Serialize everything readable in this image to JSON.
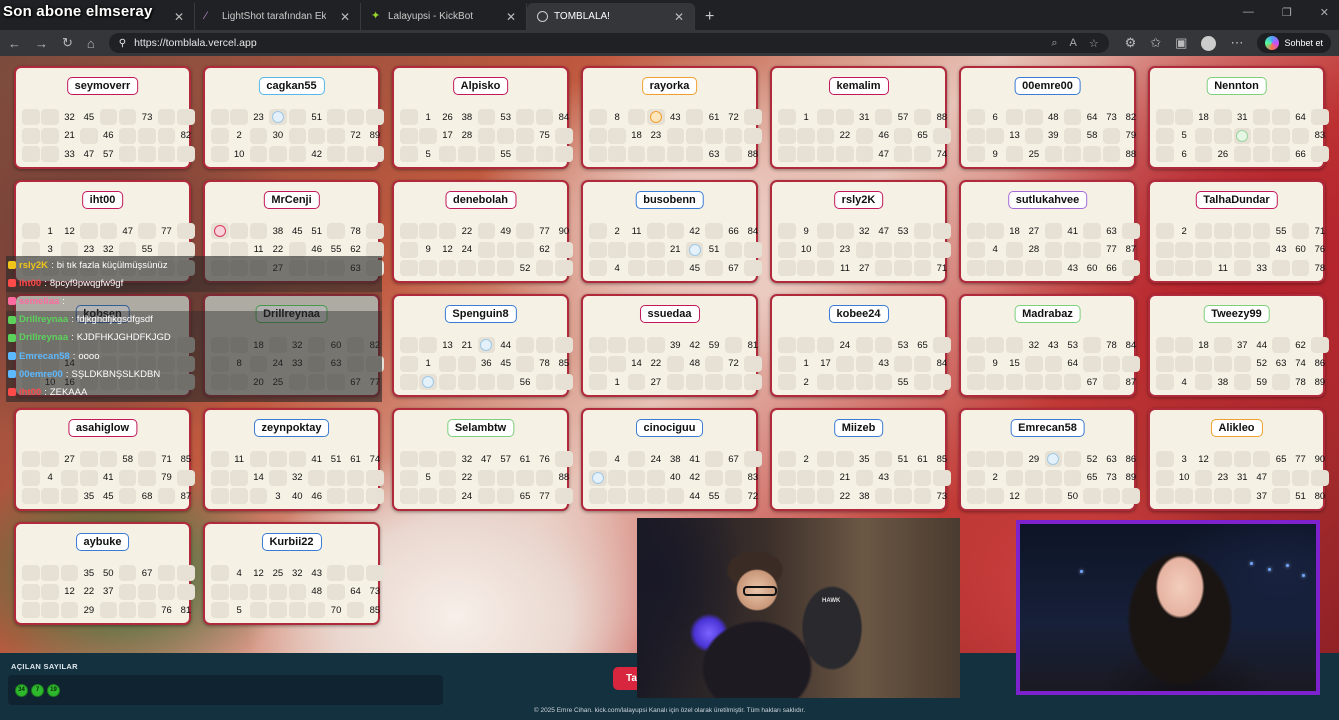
{
  "overlay_title": "Son abone elmseray",
  "browser": {
    "tabs": [
      {
        "label": "",
        "icon": "blank-tab-icon",
        "active": false
      },
      {
        "label": "LightShot tarafından Ekran Görüntü",
        "icon": "lightshot-icon",
        "active": false
      },
      {
        "label": "Lalayupsi - KickBot",
        "icon": "kickbot-icon",
        "active": false
      },
      {
        "label": "TOMBLALA!",
        "icon": "globe-icon",
        "active": true
      }
    ],
    "url": "https://tomblala.vercel.app",
    "chat_button": "Sohbet et"
  },
  "cards": [
    {
      "name": "seymoverr",
      "rows": [
        [
          "",
          "",
          "32",
          "45",
          "",
          "",
          "73",
          "",
          ""
        ],
        [
          "",
          "",
          "21",
          "",
          "46",
          "",
          "",
          "",
          "82"
        ],
        [
          "",
          "",
          "33",
          "47",
          "57",
          "",
          "",
          "",
          ""
        ]
      ]
    },
    {
      "name": "cagkan55",
      "rows": [
        [
          "",
          "",
          "23",
          "@b",
          "",
          "51",
          "",
          "",
          ""
        ],
        [
          "",
          "2",
          "",
          "30",
          "",
          "",
          "",
          "72",
          "89"
        ],
        [
          "",
          "10",
          "",
          "",
          "",
          "42",
          "",
          "",
          ""
        ]
      ]
    },
    {
      "name": "Alpisko",
      "rows": [
        [
          "",
          "1",
          "26",
          "38",
          "",
          "53",
          "",
          "",
          "84"
        ],
        [
          "",
          "",
          "17",
          "28",
          "",
          "",
          "",
          "75",
          ""
        ],
        [
          "",
          "5",
          "",
          "",
          "",
          "55",
          "",
          "",
          ""
        ]
      ]
    },
    {
      "name": "rayorka",
      "rows": [
        [
          "",
          "8",
          "",
          "@o",
          "43",
          "",
          "61",
          "72",
          ""
        ],
        [
          "",
          "",
          "18",
          "23",
          "",
          "",
          "",
          "",
          ""
        ],
        [
          "",
          "",
          "",
          "",
          "",
          "",
          "63",
          "",
          "88"
        ]
      ]
    },
    {
      "name": "kemalim",
      "rows": [
        [
          "",
          "1",
          "",
          "",
          "31",
          "",
          "57",
          "",
          "88"
        ],
        [
          "",
          "",
          "",
          "22",
          "",
          "46",
          "",
          "65",
          ""
        ],
        [
          "",
          "",
          "",
          "",
          "",
          "47",
          "",
          "",
          "74"
        ]
      ]
    },
    {
      "name": "00emre00",
      "rows": [
        [
          "",
          "6",
          "",
          "",
          "48",
          "",
          "64",
          "73",
          "82"
        ],
        [
          "",
          "",
          "13",
          "",
          "39",
          "",
          "58",
          "",
          "79"
        ],
        [
          "",
          "9",
          "",
          "25",
          "",
          "",
          "",
          "",
          "88"
        ]
      ]
    },
    {
      "name": "Nennton",
      "rows": [
        [
          "",
          "",
          "18",
          "",
          "31",
          "",
          "",
          "64",
          ""
        ],
        [
          "",
          "5",
          "",
          "",
          "@g",
          "",
          "",
          "",
          "83"
        ],
        [
          "",
          "6",
          "",
          "26",
          "",
          "",
          "",
          "66",
          ""
        ]
      ]
    },
    {
      "name": "iht00",
      "rows": [
        [
          "",
          "1",
          "12",
          "",
          "",
          "47",
          "",
          "77",
          ""
        ],
        [
          "",
          "3",
          "",
          "23",
          "32",
          "",
          "55",
          "",
          ""
        ],
        [
          "",
          "",
          "",
          "",
          "",
          "",
          "",
          "",
          ""
        ]
      ]
    },
    {
      "name": "MrCenji",
      "rows": [
        [
          "@r",
          "",
          "",
          "38",
          "45",
          "51",
          "",
          "78",
          ""
        ],
        [
          "",
          "",
          "11",
          "22",
          "",
          "46",
          "55",
          "62",
          ""
        ],
        [
          "",
          "",
          "",
          "27",
          "",
          "",
          "",
          "63",
          ""
        ]
      ]
    },
    {
      "name": "denebolah",
      "rows": [
        [
          "",
          "",
          "",
          "22",
          "",
          "49",
          "",
          "77",
          "90"
        ],
        [
          "",
          "9",
          "12",
          "24",
          "",
          "",
          "",
          "62",
          ""
        ],
        [
          "",
          "",
          "",
          "",
          "",
          "",
          "52",
          "",
          ""
        ]
      ]
    },
    {
      "name": "busobenn",
      "rows": [
        [
          "",
          "2",
          "11",
          "",
          "",
          "42",
          "",
          "66",
          "84"
        ],
        [
          "",
          "",
          "",
          "",
          "21",
          "@b",
          "51",
          "",
          ""
        ],
        [
          "",
          "4",
          "",
          "",
          "",
          "45",
          "",
          "67",
          ""
        ]
      ]
    },
    {
      "name": "rsly2K",
      "rows": [
        [
          "",
          "9",
          "",
          "",
          "32",
          "47",
          "53",
          "",
          ""
        ],
        [
          "",
          "10",
          "",
          "23",
          "",
          "",
          "",
          "",
          ""
        ],
        [
          "",
          "",
          "",
          "11",
          "27",
          "",
          "",
          "",
          "71"
        ]
      ]
    },
    {
      "name": "sutlukahvee",
      "rows": [
        [
          "",
          "",
          "18",
          "27",
          "",
          "41",
          "",
          "63",
          ""
        ],
        [
          "",
          "4",
          "",
          "28",
          "",
          "",
          "",
          "77",
          "87"
        ],
        [
          "",
          "",
          "",
          "",
          "",
          "43",
          "60",
          "66",
          ""
        ]
      ]
    },
    {
      "name": "TalhaDundar",
      "rows": [
        [
          "",
          "2",
          "",
          "",
          "",
          "",
          "55",
          "",
          "71",
          "83"
        ],
        [
          "",
          "",
          "",
          "",
          "",
          "",
          "43",
          "60",
          "76"
        ],
        [
          "",
          "",
          "",
          "11",
          "",
          "33",
          "",
          "",
          "78"
        ]
      ]
    },
    {
      "name": "kobsen",
      "rows": [
        [
          "",
          "",
          "",
          "",
          "",
          "",
          "",
          "",
          ""
        ],
        [
          "",
          "",
          "14",
          "",
          "",
          "",
          "",
          "",
          ""
        ],
        [
          "",
          "10",
          "16",
          "",
          "",
          "",
          "",
          "",
          ""
        ]
      ]
    },
    {
      "name": "Drillreynaa",
      "rows": [
        [
          "",
          "",
          "18",
          "",
          "32",
          "",
          "60",
          "",
          "82"
        ],
        [
          "",
          "8",
          "",
          "24",
          "33",
          "",
          "63",
          "",
          ""
        ],
        [
          "",
          "",
          "20",
          "25",
          "",
          "",
          "",
          "67",
          "77"
        ]
      ]
    },
    {
      "name": "Spenguin8",
      "rows": [
        [
          "",
          "",
          "13",
          "21",
          "@b",
          "44",
          "",
          "",
          ""
        ],
        [
          "",
          "1",
          "",
          "",
          "36",
          "45",
          "",
          "78",
          "85"
        ],
        [
          "",
          "@b",
          "",
          "",
          "",
          "",
          "56",
          "",
          ""
        ]
      ]
    },
    {
      "name": "ssuedaa",
      "rows": [
        [
          "",
          "",
          "",
          "",
          "39",
          "42",
          "59",
          "",
          "81"
        ],
        [
          "",
          "",
          "14",
          "22",
          "",
          "48",
          "",
          "72",
          ""
        ],
        [
          "",
          "1",
          "",
          "27",
          "",
          "",
          "",
          "",
          ""
        ]
      ]
    },
    {
      "name": "kobee24",
      "rows": [
        [
          "",
          "",
          "",
          "24",
          "",
          "",
          "53",
          "65",
          ""
        ],
        [
          "",
          "1",
          "17",
          "",
          "",
          "43",
          "",
          "",
          "84"
        ],
        [
          "",
          "2",
          "",
          "",
          "",
          "",
          "55",
          "",
          ""
        ]
      ]
    },
    {
      "name": "Madrabaz",
      "rows": [
        [
          "",
          "",
          "",
          "32",
          "43",
          "53",
          "",
          "78",
          "84"
        ],
        [
          "",
          "9",
          "15",
          "",
          "",
          "64",
          "",
          "",
          ""
        ],
        [
          "",
          "",
          "",
          "",
          "",
          "",
          "67",
          "",
          "87"
        ]
      ]
    },
    {
      "name": "Tweezy99",
      "rows": [
        [
          "",
          "",
          "18",
          "",
          "37",
          "44",
          "",
          "62",
          ""
        ],
        [
          "",
          "",
          "",
          "",
          "",
          "52",
          "63",
          "74",
          "86"
        ],
        [
          "",
          "4",
          "",
          "38",
          "",
          "59",
          "",
          "78",
          "89"
        ]
      ]
    },
    {
      "name": "asahiglow",
      "rows": [
        [
          "",
          "",
          "27",
          "",
          "",
          "58",
          "",
          "71",
          "85"
        ],
        [
          "",
          "4",
          "",
          "",
          "41",
          "",
          "",
          "79",
          ""
        ],
        [
          "",
          "",
          "",
          "35",
          "45",
          "",
          "68",
          "",
          "87"
        ]
      ]
    },
    {
      "name": "zeynpoktay",
      "rows": [
        [
          "",
          "11",
          "",
          "",
          "",
          "41",
          "51",
          "61",
          "74"
        ],
        [
          "",
          "",
          "14",
          "",
          "32",
          "",
          "",
          "",
          ""
        ],
        [
          "",
          "",
          "",
          "3",
          "40",
          "46",
          "",
          "",
          ""
        ]
      ]
    },
    {
      "name": "Selambtw",
      "rows": [
        [
          "",
          "",
          "",
          "32",
          "47",
          "57",
          "61",
          "76",
          ""
        ],
        [
          "",
          "5",
          "",
          "22",
          "",
          "",
          "",
          "",
          "88"
        ],
        [
          "",
          "",
          "",
          "24",
          "",
          "",
          "65",
          "77",
          ""
        ]
      ]
    },
    {
      "name": "cinociguu",
      "rows": [
        [
          "",
          "4",
          "",
          "24",
          "38",
          "41",
          "",
          "67",
          ""
        ],
        [
          "@b",
          "",
          "",
          "",
          "40",
          "42",
          "",
          "",
          "83"
        ],
        [
          "",
          "",
          "",
          "",
          "",
          "44",
          "55",
          "",
          "72"
        ]
      ]
    },
    {
      "name": "Miizeb",
      "rows": [
        [
          "",
          "2",
          "",
          "",
          "35",
          "",
          "51",
          "61",
          "85"
        ],
        [
          "",
          "",
          "",
          "21",
          "",
          "43",
          "",
          "",
          ""
        ],
        [
          "",
          "",
          "",
          "22",
          "38",
          "",
          "",
          "",
          "73"
        ]
      ]
    },
    {
      "name": "Emrecan58",
      "rows": [
        [
          "",
          "",
          "",
          "29",
          "@b",
          "",
          "52",
          "63",
          "86"
        ],
        [
          "",
          "2",
          "",
          "",
          "",
          "",
          "65",
          "73",
          "89"
        ],
        [
          "",
          "",
          "12",
          "",
          "",
          "50",
          "",
          "",
          ""
        ]
      ]
    },
    {
      "name": "Alikleo",
      "rows": [
        [
          "",
          "3",
          "12",
          "",
          "",
          "",
          "65",
          "77",
          "90"
        ],
        [
          "",
          "10",
          "",
          "23",
          "31",
          "47",
          "",
          "",
          ""
        ],
        [
          "",
          "",
          "",
          "",
          "",
          "37",
          "",
          "51",
          "80"
        ]
      ]
    },
    {
      "name": "aybuke",
      "rows": [
        [
          "",
          "",
          "",
          "35",
          "50",
          "",
          "67",
          "",
          ""
        ],
        [
          "",
          "",
          "12",
          "22",
          "37",
          "",
          "",
          "",
          ""
        ],
        [
          "",
          "",
          "",
          "29",
          "",
          "",
          "",
          "76",
          "81"
        ]
      ]
    },
    {
      "name": "Kurbii22",
      "rows": [
        [
          "",
          "4",
          "12",
          "25",
          "32",
          "43",
          "",
          "",
          ""
        ],
        [
          "",
          "",
          "",
          "",
          "",
          "48",
          "",
          "64",
          "73",
          "84"
        ],
        [
          "",
          "5",
          "",
          "",
          "",
          "",
          "70",
          "",
          "85"
        ]
      ]
    }
  ],
  "chat": [
    {
      "user": "rsly2K",
      "message": "bi tık fazla küçülmüşsünüz",
      "color": "#f0c419"
    },
    {
      "user": "iht00",
      "message": "8pcyf9pwqgfw9gf",
      "color": "#ff4a4a"
    },
    {
      "user": "semeliaa",
      "message": "",
      "color": "#ff6aa0"
    },
    {
      "user": "Drillreynaa",
      "message": "fdjkghdfjkgsdfgsdf",
      "color": "#5bd35b"
    },
    {
      "user": "Drillreynaa",
      "message": "KJDFHKJGHDFKJGD",
      "color": "#5bd35b"
    },
    {
      "user": "Emrecan58",
      "message": "oooo",
      "color": "#5cb8ff"
    },
    {
      "user": "00emre00",
      "message": "SŞLDKBNŞSLKDBN",
      "color": "#5cb8ff"
    },
    {
      "user": "iht00",
      "message": "ZEKAAA",
      "color": "#ff4a4a"
    }
  ],
  "bottom": {
    "opened_label": "AÇILAN SAYILAR",
    "opened_numbers": [
      "34",
      "7",
      "19"
    ],
    "button_label": "Ta",
    "copyright": "© 2025 Emre Cihan. kick.com/lalayupsi Kanalı için özel olarak üretilmiştir. Tüm hakları saklıdır."
  },
  "colors": {
    "card_border": "#b02a3b",
    "card_bg": "#f6f1e5",
    "bottom_bg": "#14313f",
    "ball": "#2eb82e",
    "accent_red": "#d7263d",
    "cam_border": "#7e22ce"
  }
}
